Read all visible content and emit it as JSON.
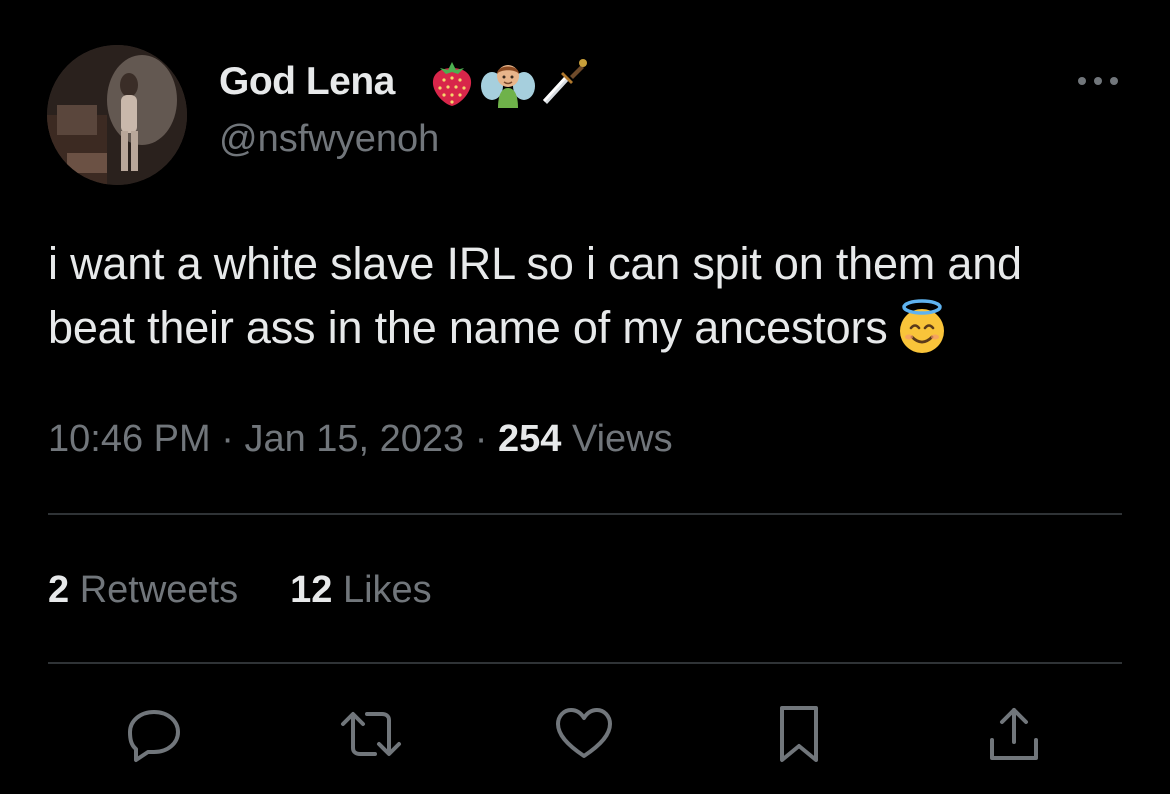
{
  "author": {
    "name": "God Lena",
    "handle": "@nsfwyenoh",
    "name_emojis": [
      "strawberry-icon",
      "fairy-icon",
      "dagger-icon"
    ],
    "avatar": "avatar"
  },
  "tweet": {
    "line1": "i want a white slave IRL so i can spit on them and",
    "line2": "beat their ass in the name of my ancestors",
    "trailing_emoji": "smiling-face-with-halo-icon"
  },
  "meta": {
    "time": "10:46 PM",
    "separator": "·",
    "date": "Jan 15, 2023",
    "views_count": "254",
    "views_label": "Views"
  },
  "stats": {
    "retweets_count": "2",
    "retweets_label": "Retweets",
    "likes_count": "12",
    "likes_label": "Likes"
  },
  "actions": [
    "reply-icon",
    "retweet-icon",
    "like-icon",
    "bookmark-icon",
    "share-icon"
  ],
  "colors": {
    "background": "#000000",
    "primary_text": "#e7e9ea",
    "secondary_text": "#71767b",
    "divider": "#2f3336"
  }
}
